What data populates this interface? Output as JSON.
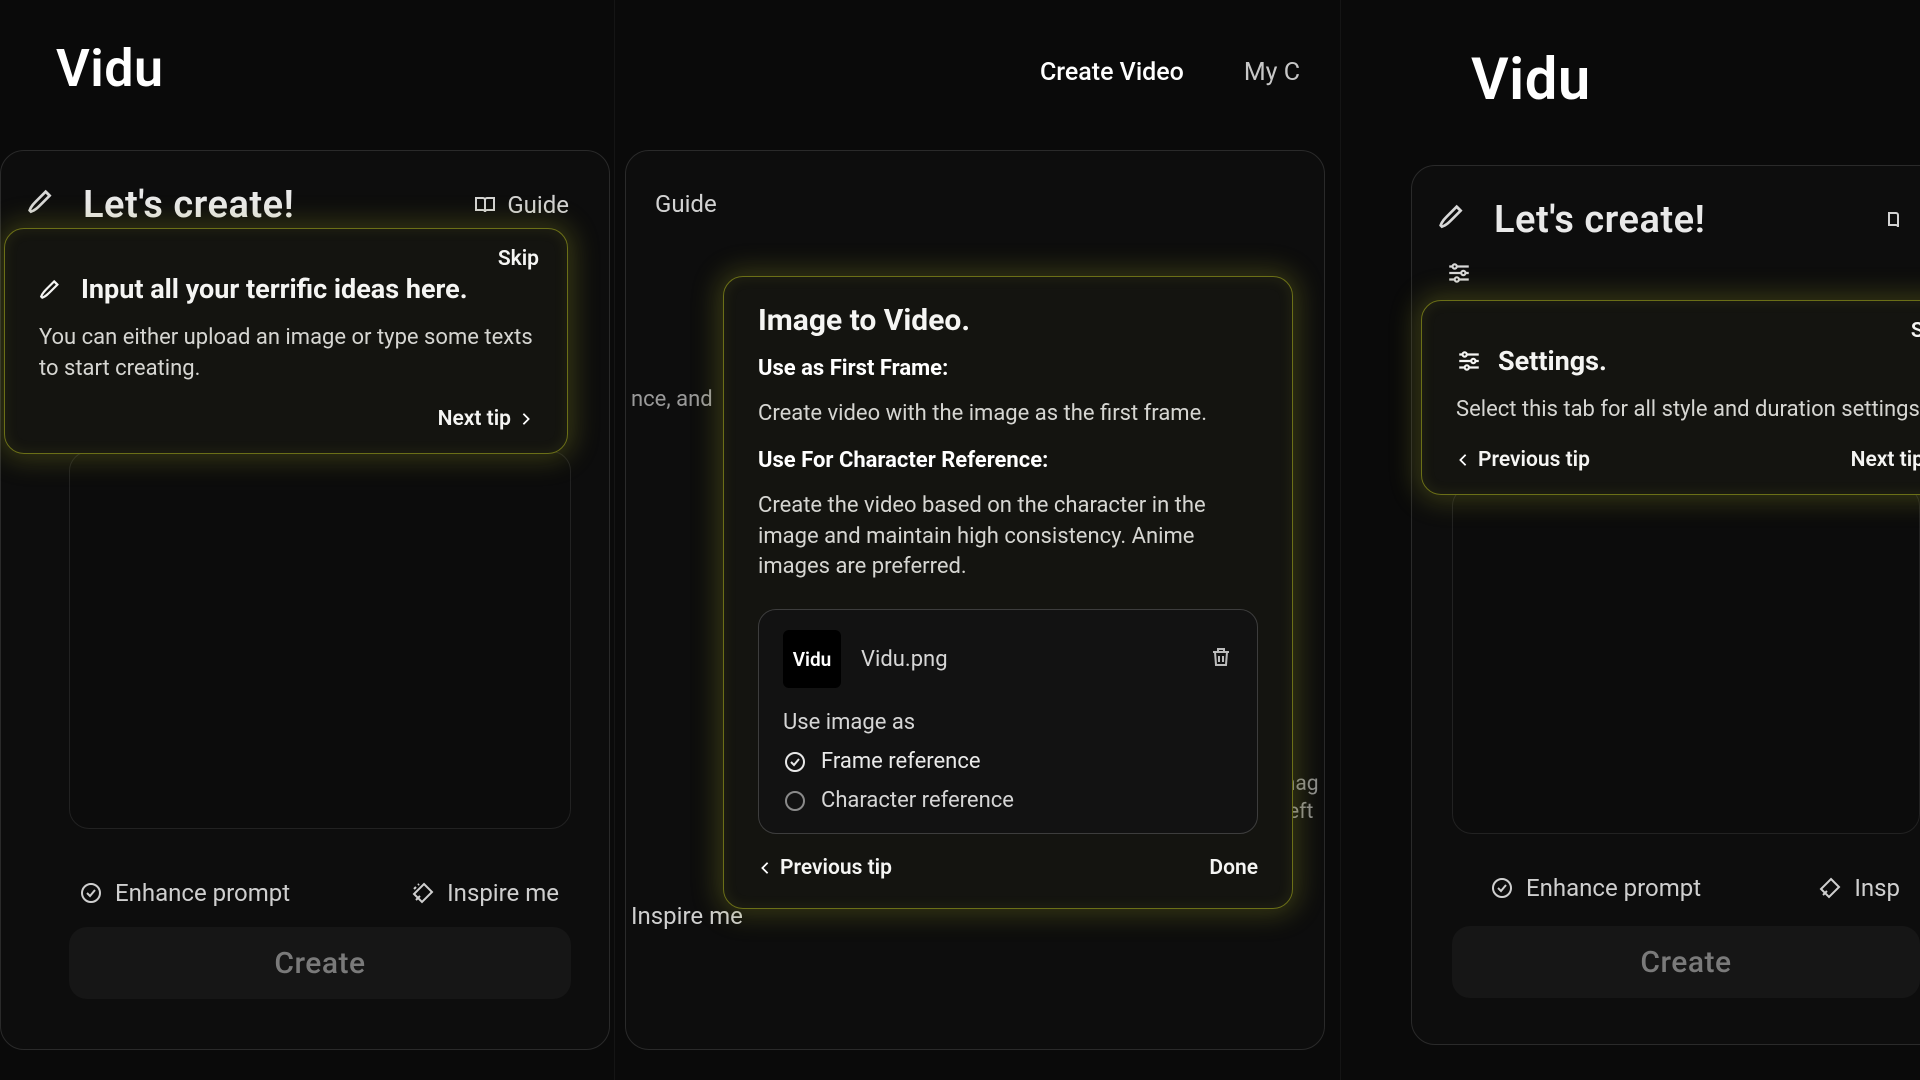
{
  "brand": "Vidu",
  "nav": {
    "create_video": "Create Video",
    "my_creations": "My C"
  },
  "panel": {
    "title": "Let's create!",
    "guide": "Guide",
    "enhance": "Enhance prompt",
    "inspire": "Inspire me",
    "inspire_short": "Insp",
    "create": "Create"
  },
  "tip_left": {
    "skip": "Skip",
    "title": "Input all your terrific ideas here.",
    "body": "You can either upload an image or type some texts to start creating.",
    "next": "Next tip"
  },
  "tip_mid": {
    "title": "Image to Video.",
    "h1": "Use as First Frame:",
    "p1": "Create video with the image as the first frame.",
    "h2": "Use For Character Reference:",
    "p2": "Create the video based on the character in the image and maintain high consistency. Anime images are preferred.",
    "file": {
      "thumb_label": "Vidu",
      "name": "Vidu.png",
      "use_as": "Use image as",
      "opt_frame": "Frame reference",
      "opt_char": "Character reference"
    },
    "prev": "Previous tip",
    "done": "Done",
    "bg_snippet": "nce, and",
    "bg_imgline1": "n imag",
    "bg_imgline2": "ne left"
  },
  "tip_right": {
    "skip": "Skip",
    "title": "Settings.",
    "body": "Select this tab for all style and duration settings.",
    "prev": "Previous tip",
    "next": "Next tip"
  },
  "mid_guide": "Guide",
  "mid_inspire": "Inspire me"
}
